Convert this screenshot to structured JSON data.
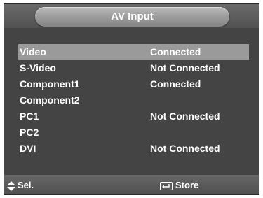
{
  "window": {
    "title": "AV Input"
  },
  "inputs": [
    {
      "name": "Video",
      "status": "Connected",
      "selected": true
    },
    {
      "name": "S-Video",
      "status": "Not Connected",
      "selected": false
    },
    {
      "name": "Component1",
      "status": "Connected",
      "selected": false
    },
    {
      "name": "Component2",
      "status": "",
      "selected": false
    },
    {
      "name": "PC1",
      "status": "Not Connected",
      "selected": false
    },
    {
      "name": "PC2",
      "status": "",
      "selected": false
    },
    {
      "name": "DVI",
      "status": "Not Connected",
      "selected": false
    }
  ],
  "footer": {
    "select_label": "Sel.",
    "select_icon": "up-down-arrows-icon",
    "store_label": "Store",
    "store_icon": "enter-key-icon"
  },
  "colors": {
    "background": "#4a4a4a",
    "highlight": "#9a9a9a",
    "text": "#ffffff"
  }
}
